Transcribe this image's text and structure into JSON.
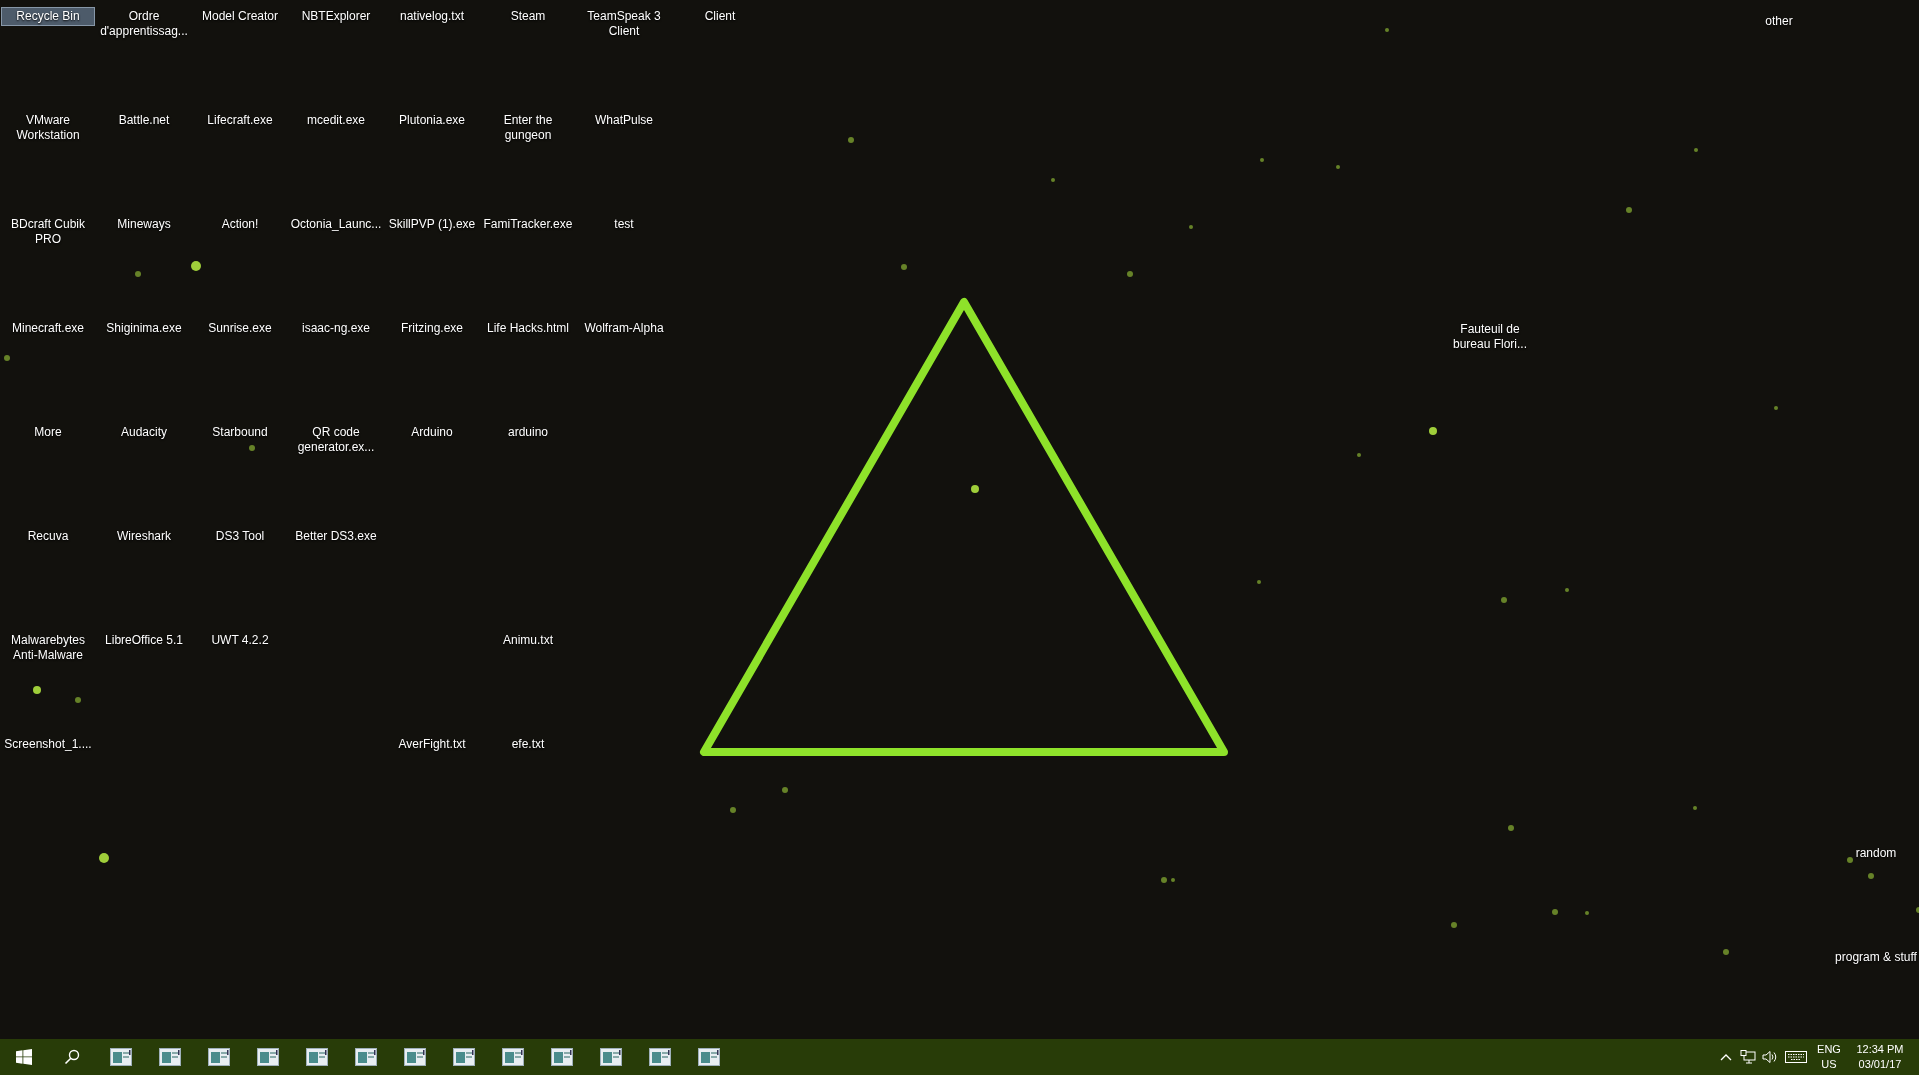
{
  "desktop": {
    "grid_rows": [
      [
        {
          "kind": "icon",
          "label": "Recycle Bin",
          "selected": true
        },
        {
          "kind": "icon",
          "label": "Ordre d'apprentissag...",
          "selected": false
        },
        {
          "kind": "icon",
          "label": "Model Creator",
          "selected": false
        },
        {
          "kind": "icon",
          "label": "NBTExplorer",
          "selected": false
        },
        {
          "kind": "icon",
          "label": "nativelog.txt",
          "selected": false
        },
        {
          "kind": "icon",
          "label": "Steam",
          "selected": false
        },
        {
          "kind": "icon",
          "label": "TeamSpeak 3 Client",
          "selected": false
        },
        {
          "kind": "icon",
          "label": "Client",
          "selected": false
        }
      ],
      [
        {
          "kind": "icon",
          "label": "VMware Workstation",
          "selected": false
        },
        {
          "kind": "icon",
          "label": "Battle.net",
          "selected": false
        },
        {
          "kind": "icon",
          "label": "Lifecraft.exe",
          "selected": false
        },
        {
          "kind": "icon",
          "label": "mcedit.exe",
          "selected": false
        },
        {
          "kind": "icon",
          "label": "Plutonia.exe",
          "selected": false
        },
        {
          "kind": "icon",
          "label": "Enter the gungeon",
          "selected": false
        },
        {
          "kind": "icon",
          "label": "WhatPulse",
          "selected": false
        }
      ],
      [
        {
          "kind": "icon",
          "label": "BDcraft Cubik PRO",
          "selected": false
        },
        {
          "kind": "icon",
          "label": "Mineways",
          "selected": false
        },
        {
          "kind": "icon",
          "label": "Action!",
          "selected": false
        },
        {
          "kind": "icon",
          "label": "Octonia_Launc...",
          "selected": false
        },
        {
          "kind": "icon",
          "label": "SkillPVP (1).exe",
          "selected": false
        },
        {
          "kind": "icon",
          "label": "FamiTracker.exe",
          "selected": false
        },
        {
          "kind": "icon",
          "label": "test",
          "selected": false
        }
      ],
      [
        {
          "kind": "icon",
          "label": "Minecraft.exe",
          "selected": false
        },
        {
          "kind": "icon",
          "label": "Shiginima.exe",
          "selected": false
        },
        {
          "kind": "icon",
          "label": "Sunrise.exe",
          "selected": false
        },
        {
          "kind": "icon",
          "label": "isaac-ng.exe",
          "selected": false
        },
        {
          "kind": "icon",
          "label": "Fritzing.exe",
          "selected": false
        },
        {
          "kind": "icon",
          "label": "Life Hacks.html",
          "selected": false
        },
        {
          "kind": "icon",
          "label": "Wolfram-Alpha",
          "selected": false
        }
      ],
      [
        {
          "kind": "icon",
          "label": "More",
          "selected": false
        },
        {
          "kind": "icon",
          "label": "Audacity",
          "selected": false
        },
        {
          "kind": "icon",
          "label": "Starbound",
          "selected": false
        },
        {
          "kind": "icon",
          "label": "QR code generator.ex...",
          "selected": false
        },
        {
          "kind": "icon",
          "label": "Arduino",
          "selected": false
        },
        {
          "kind": "icon",
          "label": "arduino",
          "selected": false
        }
      ],
      [
        {
          "kind": "icon",
          "label": "Recuva",
          "selected": false
        },
        {
          "kind": "icon",
          "label": "Wireshark",
          "selected": false
        },
        {
          "kind": "icon",
          "label": "DS3 Tool",
          "selected": false
        },
        {
          "kind": "icon",
          "label": "Better DS3.exe",
          "selected": false
        }
      ],
      [
        {
          "kind": "icon",
          "label": "Malwarebytes Anti-Malware",
          "selected": false
        },
        {
          "kind": "icon",
          "label": "LibreOffice 5.1",
          "selected": false
        },
        {
          "kind": "icon",
          "label": "UWT 4.2.2",
          "selected": false
        },
        {
          "kind": "blank"
        },
        {
          "kind": "blank"
        },
        {
          "kind": "icon",
          "label": "Animu.txt",
          "selected": false
        }
      ],
      [
        {
          "kind": "icon",
          "label": "Screenshot_1....",
          "selected": false
        },
        {
          "kind": "blank"
        },
        {
          "kind": "blank"
        },
        {
          "kind": "blank"
        },
        {
          "kind": "icon",
          "label": "AverFight.txt",
          "selected": false
        },
        {
          "kind": "icon",
          "label": "efe.txt",
          "selected": false
        }
      ]
    ],
    "free_icons": [
      {
        "label": "other",
        "selected": false
      },
      {
        "label": "Fauteuil de bureau Flori...",
        "selected": false
      },
      {
        "label": "random",
        "selected": false
      },
      {
        "label": "program & stuff",
        "selected": false
      }
    ]
  },
  "taskbar": {
    "tray": {
      "language": "ENG",
      "region": "US",
      "time": "12:34 PM",
      "date": "03/01/17"
    }
  }
}
